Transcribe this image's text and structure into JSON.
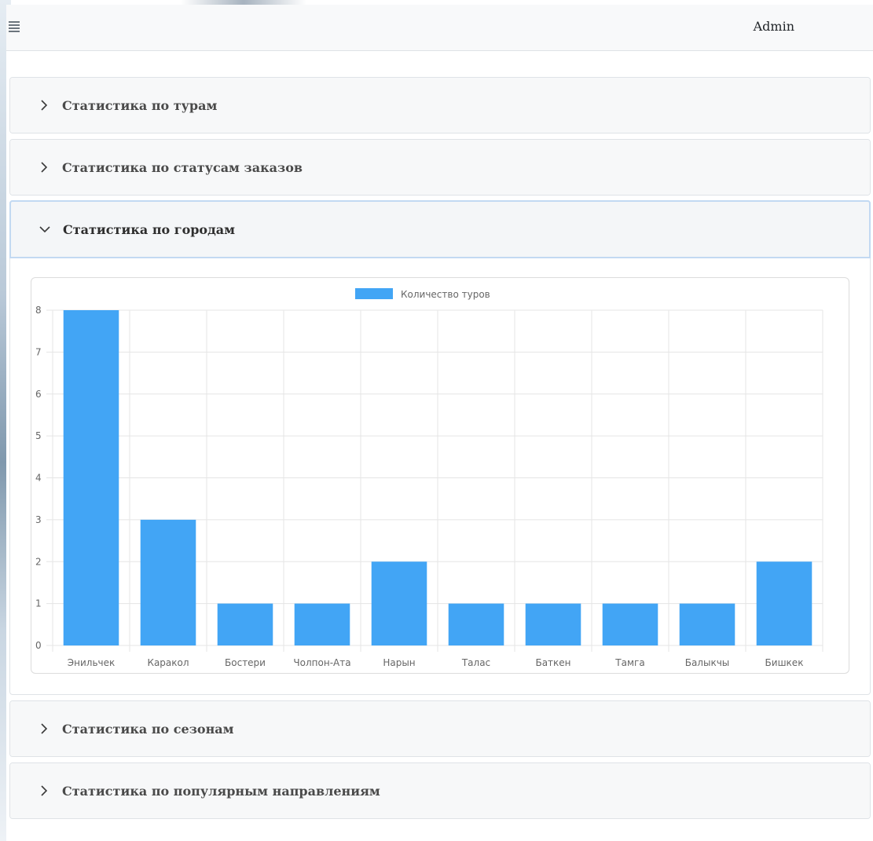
{
  "header": {
    "user_label": "Admin",
    "menu_icon": "hamburger-icon"
  },
  "sections": [
    {
      "title": "Статистика по турам",
      "expanded": false
    },
    {
      "title": "Статистика по статусам заказов",
      "expanded": false
    },
    {
      "title": "Статистика по городам",
      "expanded": true
    },
    {
      "title": "Статистика по сезонам",
      "expanded": false
    },
    {
      "title": "Статистика по популярным направлениям",
      "expanded": false
    }
  ],
  "colors": {
    "bar": "#42a5f5",
    "grid": "#e5e5e5"
  },
  "chart_data": {
    "type": "bar",
    "categories": [
      "Энильчек",
      "Каракол",
      "Бостери",
      "Чолпон-Ата",
      "Нарын",
      "Талас",
      "Баткен",
      "Тамга",
      "Балыкчы",
      "Бишкек"
    ],
    "series": [
      {
        "name": "Количество туров",
        "values": [
          8,
          3,
          1,
          1,
          2,
          1,
          1,
          1,
          1,
          2
        ]
      }
    ],
    "yticks": [
      "0",
      "1",
      "2",
      "3",
      "4",
      "5",
      "6",
      "7",
      "8"
    ],
    "ylim": [
      0,
      8
    ],
    "grid": true,
    "legend": "top-center"
  }
}
